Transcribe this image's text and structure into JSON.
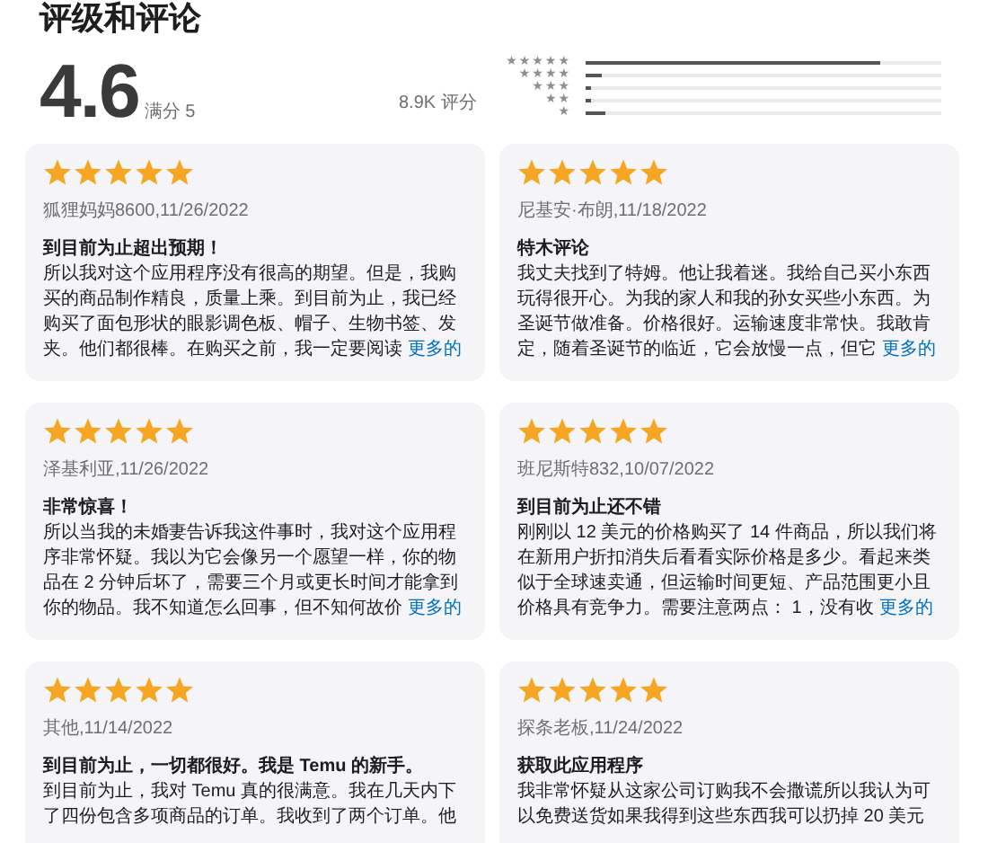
{
  "section_title": "评级和评论",
  "summary": {
    "score": "4.6",
    "out_of": "满分 5",
    "count": "8.9K 评分",
    "histogram": [
      {
        "label": "★★★★★",
        "level": 0.83
      },
      {
        "label": "★★★★",
        "level": 0.045
      },
      {
        "label": "★★★",
        "level": 0.015
      },
      {
        "label": "★★",
        "level": 0.015
      },
      {
        "label": "★",
        "level": 0.055
      }
    ]
  },
  "reviews": [
    {
      "stars": 5,
      "author": "狐狸妈妈8600,11/26/2022",
      "title": "到目前为止超出预期！",
      "body": "所以我对这个应用程序没有很高的期望。但是，我购买的商品制作精良，质量上乘。到目前为止，我已经购买了面包形状的眼影调色板、帽子、生物书签、发夹。他们都很棒。在购买之前，我一定要阅读",
      "more": "更多的"
    },
    {
      "stars": 5,
      "author": "尼基安·布朗,11/18/2022",
      "title": "特木评论",
      "body": "我丈夫找到了特姆。他让我着迷。我给自己买小东西玩得很开心。为我的家人和我的孙女买些小东西。为圣诞节做准备。价格很好。运输速度非常快。我敢肯定，随着圣诞节的临近，它会放慢一点，但它",
      "more": "更多的"
    },
    {
      "stars": 5,
      "author": "泽基利亚,11/26/2022",
      "title": "非常惊喜！",
      "body": "所以当我的未婚妻告诉我这件事时，我对这个应用程序非常怀疑。我以为它会像另一个愿望一样，你的物品在 2 分钟后坏了，需要三个月或更长时间才能拿到你的物品。我不知道怎么回事，但不知何故价",
      "more": "更多的"
    },
    {
      "stars": 5,
      "author": "班尼斯特832,10/07/2022",
      "title": "到目前为止还不错",
      "body": "刚刚以 12 美元的价格购买了 14 件商品，所以我们将在新用户折扣消失后看看实际价格是多少。看起来类似于全球速卖通，但运输时间更短、产品范围更小且价格具有竞争力。需要注意两点： 1，没有收",
      "more": "更多的"
    },
    {
      "stars": 5,
      "author": "其他,11/14/2022",
      "title": "到目前为止，一切都很好。我是 Temu 的新手。",
      "body": "到目前为止，我对 Temu 真的很满意。我在几天内下了四份包含多项商品的订单。我收到了两个订单。他"
    },
    {
      "stars": 5,
      "author": "探条老板,11/24/2022",
      "title": "获取此应用程序",
      "body": "我非常怀疑从这家公司订购我不会撒谎所以我认为可以免费送货如果我得到这些东西我可以扔掉 20 美元"
    }
  ]
}
